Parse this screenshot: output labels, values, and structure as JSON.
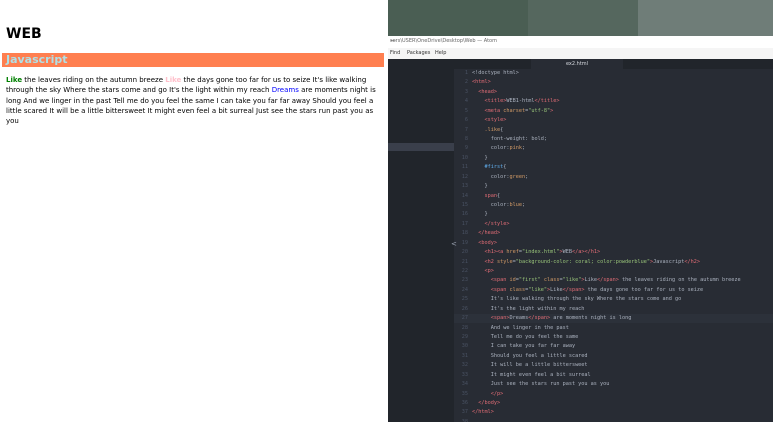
{
  "browser": {
    "h1": "WEB",
    "h2": "Javascript",
    "p": {
      "first": "Like",
      "s1": " the leaves riding on the autumn breeze ",
      "like": "Like",
      "s2": " the days gone too far for us to seize It's like walking through the sky Where the stars come and go It's the light within my reach ",
      "span": "Dreams",
      "s3": " are moments night is long And we linger in the past Tell me do you feel the same I can take you far far away Should you feel a little scared It will be a little bittersweet It might even feel a bit surreal Just see the stars run past you as you"
    }
  },
  "editor": {
    "title": "sers\\USER\\OneDrive\\Desktop\\Web — Atom",
    "menu": [
      "Find",
      "Packages",
      "Help"
    ],
    "tab": "ex2.html",
    "active_line": 27,
    "lines": [
      {
        "n": "1",
        "parts": [
          [
            "t-pun",
            "<!doctype html>"
          ]
        ]
      },
      {
        "n": "2",
        "parts": [
          [
            "t-tag",
            "<html>"
          ]
        ]
      },
      {
        "n": "3",
        "parts": [
          [
            "t-pun",
            "  "
          ],
          [
            "t-tag",
            "<head>"
          ]
        ]
      },
      {
        "n": "4",
        "parts": [
          [
            "t-pun",
            "    "
          ],
          [
            "t-tag",
            "<title>"
          ],
          [
            "t-pun",
            "WEB1-html"
          ],
          [
            "t-tag",
            "</title>"
          ]
        ]
      },
      {
        "n": "5",
        "parts": [
          [
            "t-pun",
            "    "
          ],
          [
            "t-tag",
            "<meta "
          ],
          [
            "t-attr",
            "charset"
          ],
          [
            "t-pun",
            "="
          ],
          [
            "t-str",
            "\"utf-8\""
          ],
          [
            "t-tag",
            ">"
          ]
        ]
      },
      {
        "n": "6",
        "parts": [
          [
            "t-pun",
            "    "
          ],
          [
            "t-tag",
            "<style>"
          ]
        ]
      },
      {
        "n": "7",
        "parts": [
          [
            "t-pun",
            "    "
          ],
          [
            "t-sel",
            ".like"
          ],
          [
            "t-pun",
            "{"
          ]
        ]
      },
      {
        "n": "8",
        "parts": [
          [
            "t-pun",
            "      font-weight: bold;"
          ]
        ]
      },
      {
        "n": "9",
        "parts": [
          [
            "t-pun",
            "      color:"
          ],
          [
            "t-attr",
            "pink"
          ],
          [
            "t-pun",
            ";"
          ]
        ]
      },
      {
        "n": "10",
        "parts": [
          [
            "t-pun",
            "    }"
          ]
        ]
      },
      {
        "n": "11",
        "parts": [
          [
            "t-pun",
            "    "
          ],
          [
            "t-id",
            "#first"
          ],
          [
            "t-pun",
            "{"
          ]
        ]
      },
      {
        "n": "12",
        "parts": [
          [
            "t-pun",
            "      color:"
          ],
          [
            "t-attr",
            "green"
          ],
          [
            "t-pun",
            ";"
          ]
        ]
      },
      {
        "n": "13",
        "parts": [
          [
            "t-pun",
            "    }"
          ]
        ]
      },
      {
        "n": "14",
        "parts": [
          [
            "t-pun",
            "    "
          ],
          [
            "t-tag",
            "span"
          ],
          [
            "t-pun",
            "{"
          ]
        ]
      },
      {
        "n": "15",
        "parts": [
          [
            "t-pun",
            "      color:"
          ],
          [
            "t-attr",
            "blue"
          ],
          [
            "t-pun",
            ";"
          ]
        ]
      },
      {
        "n": "16",
        "parts": [
          [
            "t-pun",
            "    }"
          ]
        ]
      },
      {
        "n": "17",
        "parts": [
          [
            "t-pun",
            "    "
          ],
          [
            "t-tag",
            "</style>"
          ]
        ]
      },
      {
        "n": "18",
        "parts": [
          [
            "t-pun",
            "  "
          ],
          [
            "t-tag",
            "</head>"
          ]
        ]
      },
      {
        "n": "19",
        "parts": [
          [
            "t-pun",
            "  "
          ],
          [
            "t-tag",
            "<body>"
          ]
        ]
      },
      {
        "n": "20",
        "parts": [
          [
            "t-pun",
            "    "
          ],
          [
            "t-tag",
            "<h1><a "
          ],
          [
            "t-attr",
            "href"
          ],
          [
            "t-pun",
            "="
          ],
          [
            "t-str",
            "\"index.html\""
          ],
          [
            "t-tag",
            ">"
          ],
          [
            "t-pun",
            "WEB"
          ],
          [
            "t-tag",
            "</a></h1>"
          ]
        ]
      },
      {
        "n": "21",
        "parts": [
          [
            "t-pun",
            "    "
          ],
          [
            "t-tag",
            "<h2 "
          ],
          [
            "t-attr",
            "style"
          ],
          [
            "t-pun",
            "="
          ],
          [
            "t-str",
            "\"background-color: coral; color:powderblue\""
          ],
          [
            "t-tag",
            ">"
          ],
          [
            "t-pun",
            "Javascript"
          ],
          [
            "t-tag",
            "</h2>"
          ]
        ]
      },
      {
        "n": "22",
        "parts": [
          [
            "t-pun",
            "    "
          ],
          [
            "t-tag",
            "<p>"
          ]
        ]
      },
      {
        "n": "23",
        "parts": [
          [
            "t-pun",
            "      "
          ],
          [
            "t-tag",
            "<span "
          ],
          [
            "t-attr",
            "id"
          ],
          [
            "t-pun",
            "="
          ],
          [
            "t-str",
            "\"first\""
          ],
          [
            "t-pun",
            " "
          ],
          [
            "t-attr",
            "class"
          ],
          [
            "t-pun",
            "="
          ],
          [
            "t-str",
            "\"like\""
          ],
          [
            "t-tag",
            ">"
          ],
          [
            "t-pun",
            "Like"
          ],
          [
            "t-tag",
            "</span>"
          ],
          [
            "t-pun",
            " the leaves riding on the autumn breeze"
          ]
        ]
      },
      {
        "n": "24",
        "parts": [
          [
            "t-pun",
            "      "
          ],
          [
            "t-tag",
            "<span "
          ],
          [
            "t-attr",
            "class"
          ],
          [
            "t-pun",
            "="
          ],
          [
            "t-str",
            "\"like\""
          ],
          [
            "t-tag",
            ">"
          ],
          [
            "t-pun",
            "Like"
          ],
          [
            "t-tag",
            "</span>"
          ],
          [
            "t-pun",
            " the days gone too far for us to seize"
          ]
        ]
      },
      {
        "n": "25",
        "parts": [
          [
            "t-pun",
            "      It's like walking through the sky Where the stars come and go"
          ]
        ]
      },
      {
        "n": "26",
        "parts": [
          [
            "t-pun",
            "      It's the light within my reach"
          ]
        ]
      },
      {
        "n": "27",
        "parts": [
          [
            "t-pun",
            "      "
          ],
          [
            "t-tag",
            "<span>"
          ],
          [
            "t-pun",
            "Dreams"
          ],
          [
            "t-tag",
            "</span>"
          ],
          [
            "t-pun",
            " are moments night is long"
          ]
        ]
      },
      {
        "n": "28",
        "parts": [
          [
            "t-pun",
            "      And we linger in the past"
          ]
        ]
      },
      {
        "n": "29",
        "parts": [
          [
            "t-pun",
            "      Tell me do you feel the same"
          ]
        ]
      },
      {
        "n": "30",
        "parts": [
          [
            "t-pun",
            "      I can take you far far away"
          ]
        ]
      },
      {
        "n": "31",
        "parts": [
          [
            "t-pun",
            "      Should you feel a little scared"
          ]
        ]
      },
      {
        "n": "32",
        "parts": [
          [
            "t-pun",
            "      It will be a little bittersweet"
          ]
        ]
      },
      {
        "n": "33",
        "parts": [
          [
            "t-pun",
            "      It might even feel a bit surreal"
          ]
        ]
      },
      {
        "n": "34",
        "parts": [
          [
            "t-pun",
            "      Just see the stars run past you as you"
          ]
        ]
      },
      {
        "n": "35",
        "parts": [
          [
            "t-pun",
            "      "
          ],
          [
            "t-tag",
            "</p>"
          ]
        ]
      },
      {
        "n": "36",
        "parts": [
          [
            "t-pun",
            "  "
          ],
          [
            "t-tag",
            "</body>"
          ]
        ]
      },
      {
        "n": "37",
        "parts": [
          [
            "t-tag",
            "</html>"
          ]
        ]
      },
      {
        "n": "38",
        "parts": []
      }
    ]
  }
}
